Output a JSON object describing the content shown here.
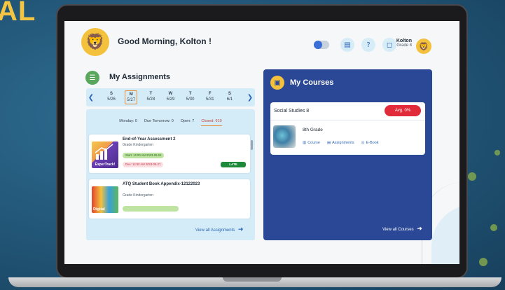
{
  "background": {
    "text": "AL"
  },
  "header": {
    "greeting": "Good Morning, Kolton !",
    "user_name": "Kolton",
    "user_grade": "Grade 8"
  },
  "assignments": {
    "title": "My Assignments",
    "calendar": [
      {
        "day": "S",
        "date": "5/26",
        "selected": false
      },
      {
        "day": "M",
        "date": "5/27",
        "selected": true
      },
      {
        "day": "T",
        "date": "5/28",
        "selected": false
      },
      {
        "day": "W",
        "date": "5/29",
        "selected": false
      },
      {
        "day": "T",
        "date": "5/30",
        "selected": false
      },
      {
        "day": "F",
        "date": "5/31",
        "selected": false
      },
      {
        "day": "S",
        "date": "6/1",
        "selected": false
      }
    ],
    "filters": [
      {
        "label": "Monday: 0"
      },
      {
        "label": "Due Tomorrow: 0"
      },
      {
        "label": "Open: 7"
      },
      {
        "label": "Closed: 610"
      }
    ],
    "cards": [
      {
        "title": "End-of-Year Assessment 2",
        "grade": "Grade Kindergarten",
        "thumb_text": "ExperTrack!",
        "start": "Start: 12:00 AM 2023-05-02",
        "due": "Due: 12:00 AM 2023-05-27",
        "badge": "LATE"
      },
      {
        "title": "ATQ Student Book Appendix-12122023",
        "grade": "Grade Kindergarten",
        "thumb_text": "Digital"
      }
    ],
    "view_all": "View all Assignments"
  },
  "courses": {
    "title": "My Courses",
    "items": [
      {
        "name": "Social Studies 8",
        "avg": "Avg. 0%",
        "grade": "8th Grade",
        "links": [
          "Course",
          "Assignments",
          "E-Book"
        ]
      }
    ],
    "view_all": "View all Courses"
  },
  "colors": {
    "course_panel": "#2a4895",
    "accent_orange": "#e58d3b",
    "late_green": "#1d8a3b",
    "avg_red": "#e12b3a",
    "light_panel": "#d4ecf7"
  }
}
